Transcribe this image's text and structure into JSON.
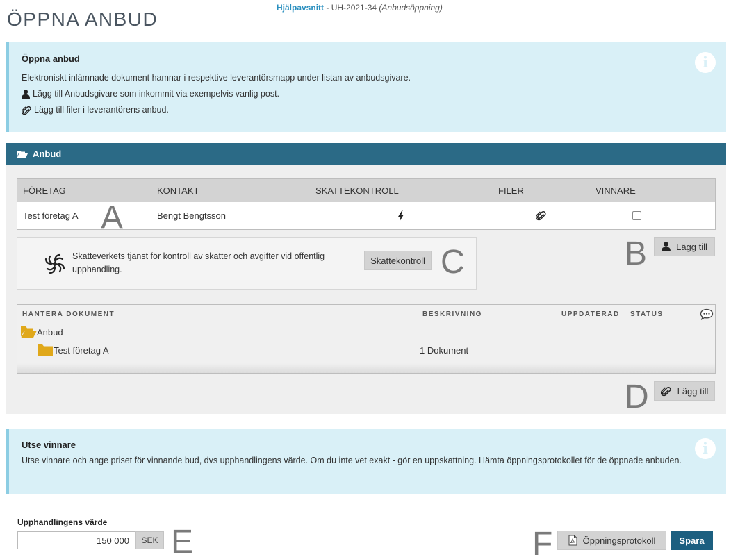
{
  "header": {
    "title": "ÖPPNA ANBUD",
    "help_link": "Hjälpavsnitt",
    "case_id": "UH-2021-34",
    "case_phase": "(Anbudsöppning)"
  },
  "info_open": {
    "title": "Öppna anbud",
    "line1": "Elektroniskt inlämnade dokument hamnar i respektive leverantörsmapp under listan av anbudsgivare.",
    "line2": "Lägg till Anbudsgivare som inkommit via exempelvis vanlig post.",
    "line3": "Lägg till filer i leverantörens anbud."
  },
  "bids_panel": {
    "title": "Anbud",
    "columns": {
      "company": "Företag",
      "contact": "Kontakt",
      "tax_check": "Skattekontroll",
      "files": "Filer",
      "winner": "Vinnare"
    },
    "rows": [
      {
        "company": "Test företag A",
        "contact": "Bengt Bengtsson",
        "winner": false
      }
    ],
    "add_bidder_label": "Lägg till",
    "skatteverket_text": "Skatteverkets tjänst för kontroll av skatter och avgifter vid offentlig upphandling.",
    "tax_check_button": "Skattekontroll"
  },
  "documents": {
    "columns": {
      "manage": "HANTERA DOKUMENT",
      "description": "BESKRIVNING",
      "updated": "UPPDATERAD",
      "status": "STATUS"
    },
    "root_folder": "Anbud",
    "items": [
      {
        "name": "Test företag A",
        "description": "1 Dokument"
      }
    ],
    "add_file_label": "Lägg till"
  },
  "markers": {
    "a": "A",
    "b": "B",
    "c": "C",
    "d": "D",
    "e": "E",
    "f": "F"
  },
  "info_winner": {
    "title": "Utse vinnare",
    "text": "Utse vinnare och ange priset för vinnande bud, dvs upphandlingens värde. Om du inte vet exakt - gör en uppskattning. Hämta öppningsprotokollet för de öppnade anbuden."
  },
  "procurement_value": {
    "label": "Upphandlingens värde",
    "value": "150 000",
    "currency": "SEK"
  },
  "actions": {
    "protocol_label": "Öppningsprotokoll",
    "save_label": "Spara"
  },
  "colors": {
    "panel_header": "#2b6a86",
    "info_bg": "#d9f0f7",
    "folder": "#e0a81a",
    "save_button": "#1c5f80",
    "help_link": "#2a8fbf"
  }
}
